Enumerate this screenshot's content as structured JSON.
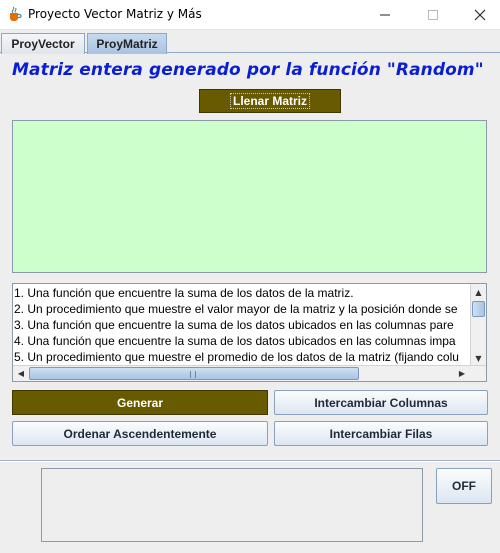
{
  "window": {
    "title": "Proyecto Vector Matriz y Más",
    "app_icon": "java-cup-icon",
    "controls": {
      "minimize": "minimize-icon",
      "maximize": "maximize-icon",
      "close": "close-icon"
    }
  },
  "tabs": [
    {
      "label": "ProyVector",
      "selected": false
    },
    {
      "label": "ProyMatriz",
      "selected": true
    }
  ],
  "heading": "Matriz entera generado por la función \"Random\"",
  "fill_button": {
    "label": "Llenar Matriz"
  },
  "matrix_area": {
    "background": "#ccffcc",
    "content": ""
  },
  "task_list": {
    "items": [
      "1. Una función que encuentre  la suma de los datos de la matriz.",
      "2. Un procedimiento que muestre el valor mayor de la matriz y la posición donde se",
      "3. Una función que encuentre la suma de los datos ubicados en las columnas pare",
      "4. Una función que encuentre la suma de los datos ubicados en las columnas impa",
      "5. Un procedimiento que muestre el promedio de los datos de la matriz (fijando colu"
    ]
  },
  "buttons": {
    "generar": "Generar",
    "intercambiar_columnas": "Intercambiar Columnas",
    "ordenar": "Ordenar Ascendentemente",
    "intercambiar_filas": "Intercambiar Filas",
    "off": "OFF"
  },
  "output_box": {
    "content": ""
  },
  "colors": {
    "accent_olive": "#675a00",
    "heading_blue": "#0a1fd4",
    "matrix_green": "#ccffcc",
    "tab_selected": "#b8cfe8"
  }
}
